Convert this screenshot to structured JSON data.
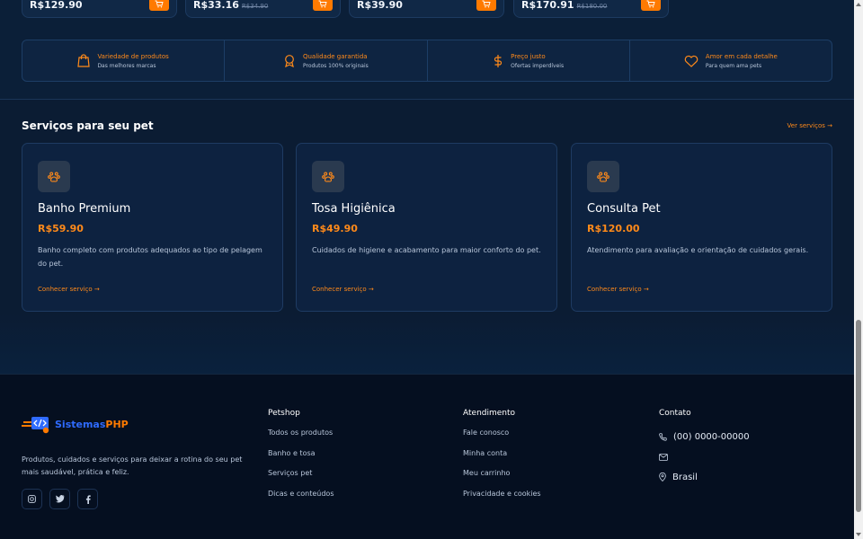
{
  "products": [
    {
      "price": "R$129.90",
      "old_price": ""
    },
    {
      "price": "R$33.16",
      "old_price": "R$34.90"
    },
    {
      "price": "R$39.90",
      "old_price": ""
    },
    {
      "price": "R$170.91",
      "old_price": "R$180.00"
    }
  ],
  "features": [
    {
      "icon": "shopping-bag-icon",
      "title": "Variedade de produtos",
      "subtitle": "Das melhores marcas"
    },
    {
      "icon": "award-icon",
      "title": "Qualidade garantida",
      "subtitle": "Produtos 100% originais"
    },
    {
      "icon": "dollar-icon",
      "title": "Preço justo",
      "subtitle": "Ofertas imperdíveis"
    },
    {
      "icon": "heart-icon",
      "title": "Amor em cada detalhe",
      "subtitle": "Para quem ama pets"
    }
  ],
  "services": {
    "title": "Serviços para seu pet",
    "link": "Ver serviços →",
    "items": [
      {
        "icon": "paw-icon",
        "name": "Banho Premium",
        "price": "R$59.90",
        "description": "Banho completo com produtos adequados ao tipo de pelagem do pet.",
        "link": "Conhecer serviço →"
      },
      {
        "icon": "paw-icon",
        "name": "Tosa Higiênica",
        "price": "R$49.90",
        "description": "Cuidados de higiene e acabamento para maior conforto do pet.",
        "link": "Conhecer serviço →"
      },
      {
        "icon": "paw-icon",
        "name": "Consulta Pet",
        "price": "R$120.00",
        "description": "Atendimento para avaliação e orientação de cuidados gerais.",
        "link": "Conhecer serviço →"
      }
    ]
  },
  "footer": {
    "logo": {
      "part1": "Sistemas",
      "part2": "PHP"
    },
    "description": "Produtos, cuidados e serviços para deixar a rotina do seu pet mais saudável, prática e feliz.",
    "socials": [
      "instagram-icon",
      "twitter-icon",
      "facebook-icon"
    ],
    "petshop": {
      "title": "Petshop",
      "items": [
        "Todos os produtos",
        "Banho e tosa",
        "Serviços pet",
        "Dicas e conteúdos"
      ]
    },
    "atendimento": {
      "title": "Atendimento",
      "items": [
        "Fale conosco",
        "Minha conta",
        "Meu carrinho",
        "Privacidade e cookies"
      ]
    },
    "contato": {
      "title": "Contato",
      "phone": "(00) 0000-00000",
      "email": "",
      "location": "Brasil"
    }
  },
  "colors": {
    "accent": "#ff7a00",
    "background": "#0b1c33",
    "footer_bg": "#050f20",
    "brand_blue": "#2f6bff"
  }
}
